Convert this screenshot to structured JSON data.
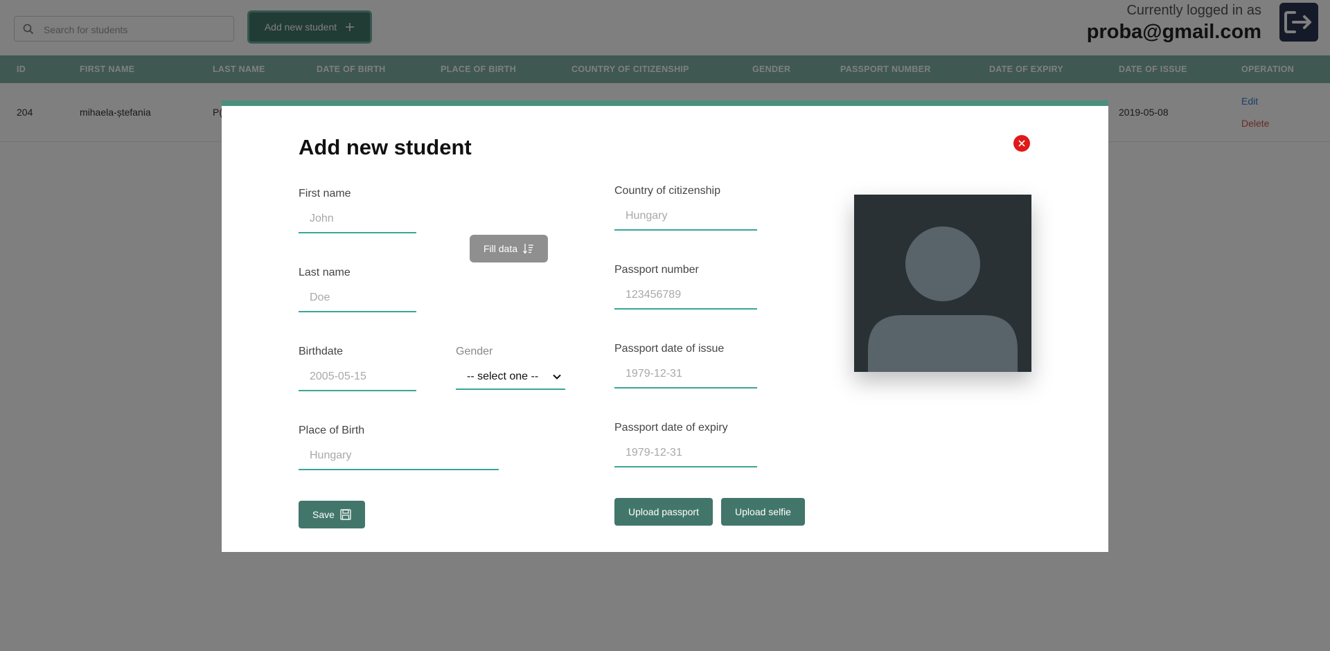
{
  "header": {
    "search_placeholder": "Search for students",
    "add_button_label": "Add new student",
    "login_label": "Currently logged in as",
    "login_email": "proba@gmail.com"
  },
  "table": {
    "columns": [
      "ID",
      "FIRST NAME",
      "LAST NAME",
      "DATE OF BIRTH",
      "PLACE OF BIRTH",
      "COUNTRY OF CITIZENSHIP",
      "GENDER",
      "PASSPORT NUMBER",
      "DATE OF EXPIRY",
      "DATE OF ISSUE",
      "OPERATION"
    ],
    "row": {
      "id": "204",
      "first_name": "mihaela-ștefania",
      "last_name_partial": "P(",
      "date_of_issue": "2019-05-08",
      "edit_label": "Edit",
      "delete_label": "Delete"
    }
  },
  "modal": {
    "title": "Add new student",
    "first_name_label": "First name",
    "first_name_placeholder": "John",
    "last_name_label": "Last name",
    "last_name_placeholder": "Doe",
    "birthdate_label": "Birthdate",
    "birthdate_placeholder": "2005-05-15",
    "gender_label": "Gender",
    "gender_selected": "-- select one --",
    "place_of_birth_label": "Place of Birth",
    "place_of_birth_placeholder": "Hungary",
    "fill_data_label": "Fill data",
    "country_label": "Country of citizenship",
    "country_placeholder": "Hungary",
    "passport_number_label": "Passport number",
    "passport_number_placeholder": "123456789",
    "passport_issue_label": "Passport date of issue",
    "passport_issue_placeholder": "1979-12-31",
    "passport_expiry_label": "Passport date of expiry",
    "passport_expiry_placeholder": "1979-12-31",
    "save_label": "Save",
    "upload_passport_label": "Upload passport",
    "upload_selfie_label": "Upload selfie"
  },
  "colors": {
    "accent": "#42766b",
    "header_row": "#7fb0a4",
    "input_underline": "#3aa597",
    "close_red": "#e01919",
    "edit_link": "#3d7bd5",
    "delete_link": "#d9534f"
  },
  "icons": [
    "search-icon",
    "plus-icon",
    "logout-icon",
    "close-icon",
    "sort-icon",
    "save-icon",
    "chevron-down-icon",
    "avatar-placeholder-icon"
  ]
}
